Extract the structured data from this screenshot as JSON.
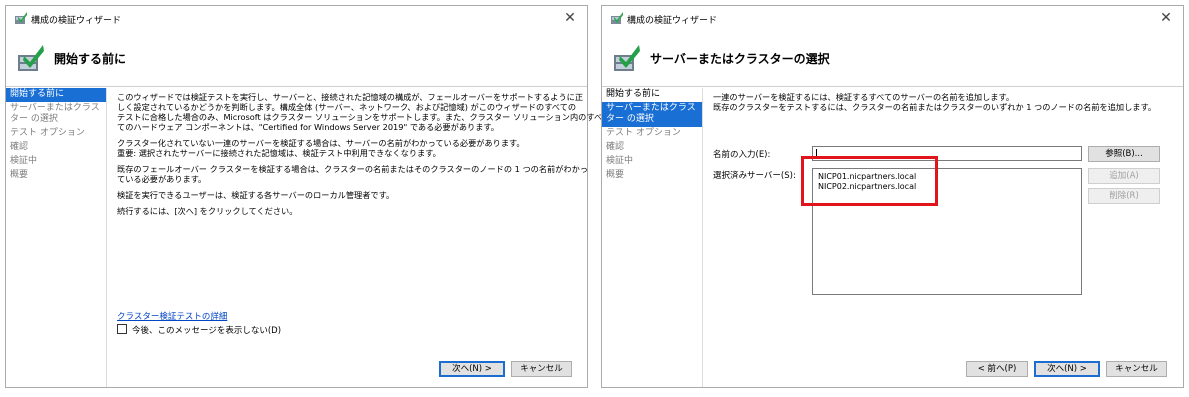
{
  "icons": {
    "title": "wizard-icon",
    "header": "validation-wizard-icon",
    "close": "close-icon"
  },
  "colors": {
    "accent": "#1a6fd5",
    "link": "#0046c5",
    "highlight": "#e0141a"
  },
  "window1": {
    "title": "構成の検証ウィザード",
    "close": "✕",
    "page_title": "開始する前に",
    "nav": [
      "開始する前に",
      "サーバーまたはクラスター の選択",
      "テスト オプション",
      "確認",
      "検証中",
      "概要"
    ],
    "para1": [
      "このウィザードでは検証テストを実行し、サーバーと、接続された記憶域の構成が、フェールオーバーをサポートするように正",
      "しく設定されているかどうかを判断します。構成全体 (サーバー、ネットワーク、および記憶域) がこのウィザードのすべての",
      "テストに合格した場合のみ、Microsoft はクラスター ソリューションをサポートします。また、クラスター ソリューション内のすべ",
      "てのハードウェア コンポーネントは、\"Certified for Windows Server 2019\" である必要があります。"
    ],
    "para2": [
      "クラスター化されていない一連のサーバーを検証する場合は、サーバーの名前がわかっている必要があります。",
      "重要: 選択されたサーバーに接続された記憶域は、検証テスト中利用できなくなります。"
    ],
    "para3": [
      "既存のフェールオーバー クラスターを検証する場合は、クラスターの名前またはそのクラスターのノードの 1 つの名前がわかっ",
      "ている必要があります。"
    ],
    "para4": [
      "検証を実行できるユーザーは、検証する各サーバーのローカル管理者です。"
    ],
    "para5": [
      "続行するには、[次へ] をクリックしてください。"
    ],
    "link": "クラスター検証テストの詳細",
    "checkbox_label": "今後、このメッセージを表示しない(D)",
    "next_button": "次へ(N) >",
    "cancel_button": "キャンセル"
  },
  "window2": {
    "title": "構成の検証ウィザード",
    "close": "✕",
    "page_title": "サーバーまたはクラスターの選択",
    "nav": [
      "開始する前に",
      "サーバーまたはクラスター の選択",
      "テスト オプション",
      "確認",
      "検証中",
      "概要"
    ],
    "intro": [
      "一連のサーバーを検証するには、検証するすべてのサーバーの名前を追加します。",
      "既存のクラスターをテストするには、クラスターの名前またはクラスターのいずれか 1 つのノードの名前を追加します。"
    ],
    "name_label": "名前の入力(E):",
    "name_value": "",
    "selected_label": "選択済みサーバー(S):",
    "servers": [
      "NICP01.nicpartners.local",
      "NICP02.nicpartners.local"
    ],
    "browse_button": "参照(B)...",
    "add_button": "追加(A)",
    "remove_button": "削除(R)",
    "back_button": "< 前へ(P)",
    "next_button": "次へ(N) >",
    "cancel_button": "キャンセル"
  }
}
